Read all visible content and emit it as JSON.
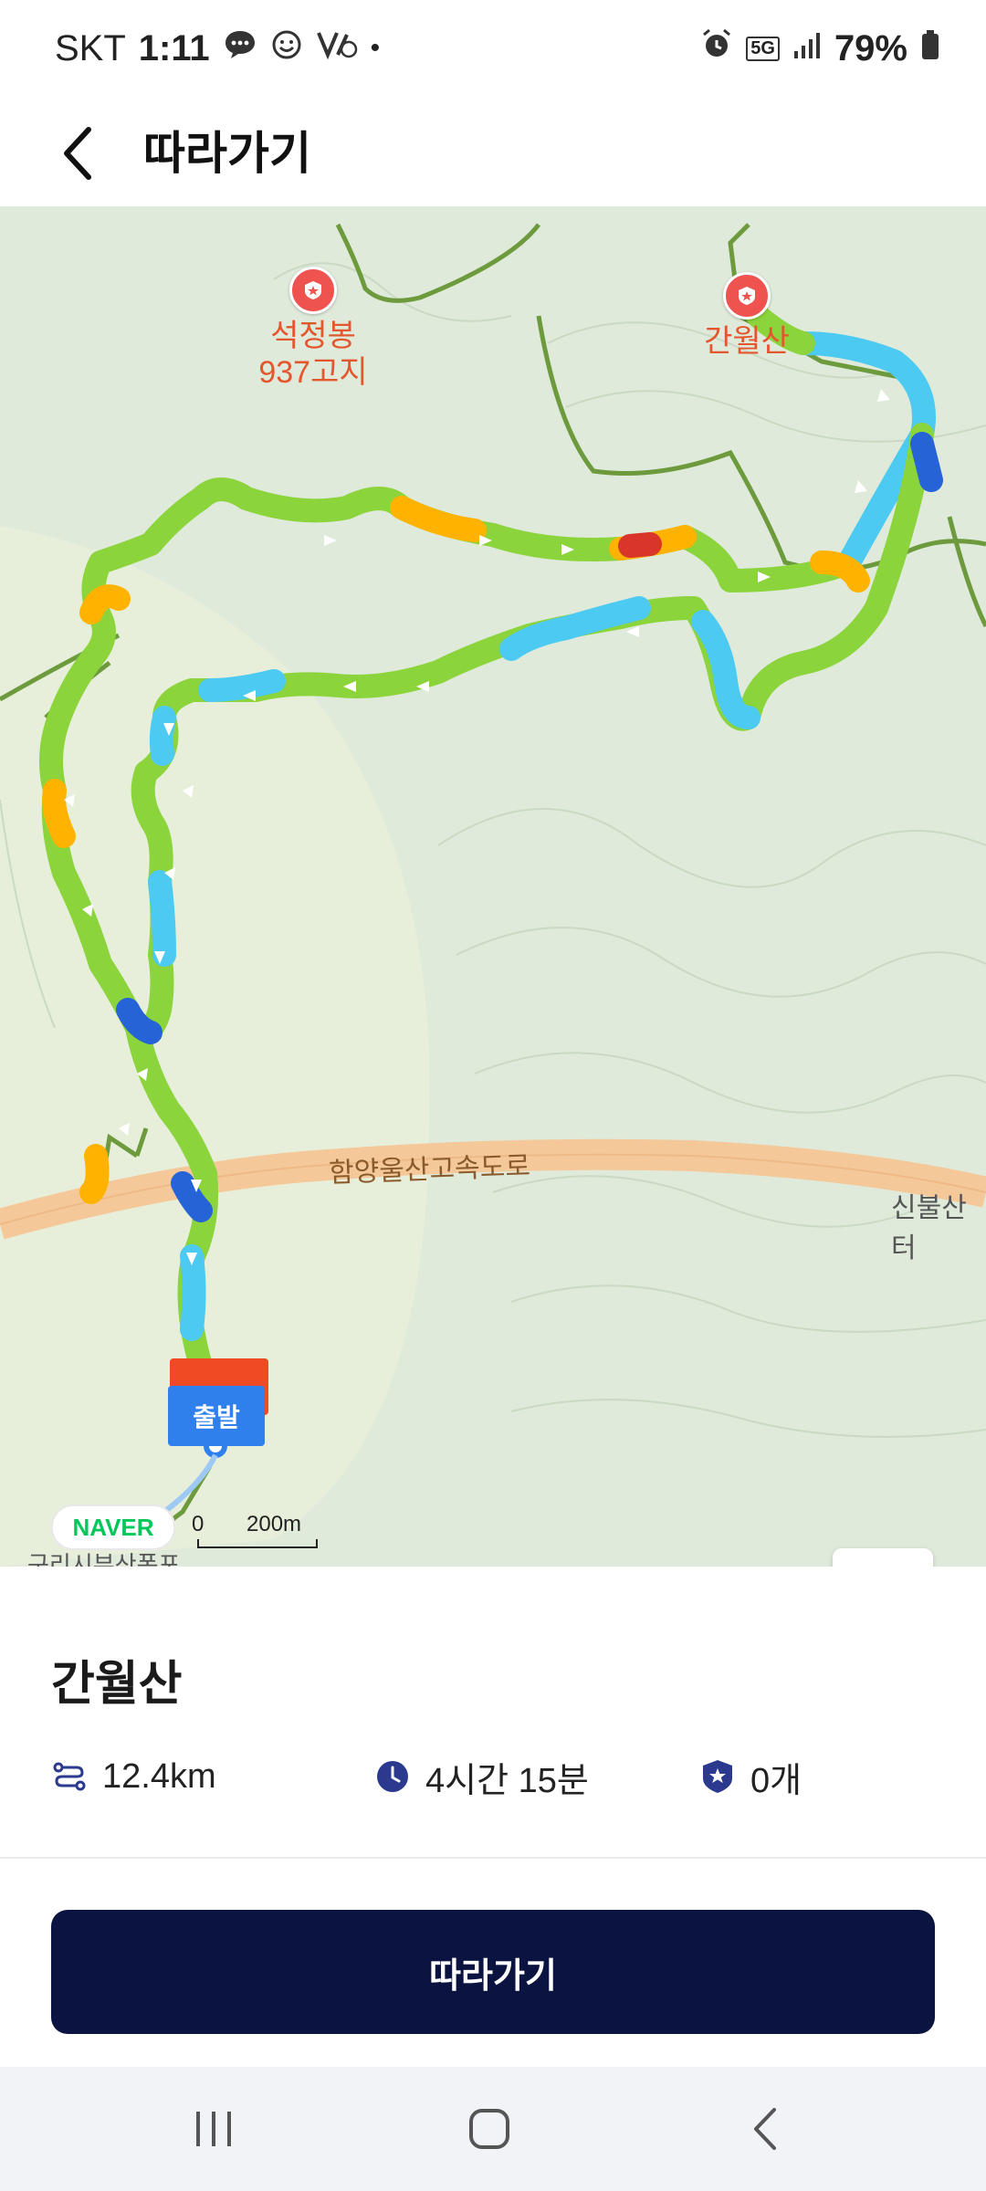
{
  "status_bar": {
    "carrier": "SKT",
    "time": "1:11",
    "network": "5G",
    "battery": "79%"
  },
  "header": {
    "title": "따라가기"
  },
  "map": {
    "peaks": [
      {
        "name_line1": "석정봉",
        "name_line2": "937고지"
      },
      {
        "name_line1": "간월산",
        "name_line2": ""
      }
    ],
    "road_labels": [
      "함양울산고속도로",
      "신불산터"
    ],
    "start_label": "출발",
    "naver_logo": "NAVER",
    "scale_zero": "0",
    "scale_distance": "200m",
    "bottom_place": "구리시부산폭포"
  },
  "trail": {
    "name": "간월산",
    "distance": "12.4km",
    "duration": "4시간 15분",
    "stamps": "0개"
  },
  "action": {
    "follow_label": "따라가기"
  },
  "colors": {
    "primary_button": "#0b1440",
    "route_green": "#8cd43c",
    "route_blue": "#4ccaf2",
    "route_orange": "#ffb300",
    "peak_red": "#ef5350"
  }
}
